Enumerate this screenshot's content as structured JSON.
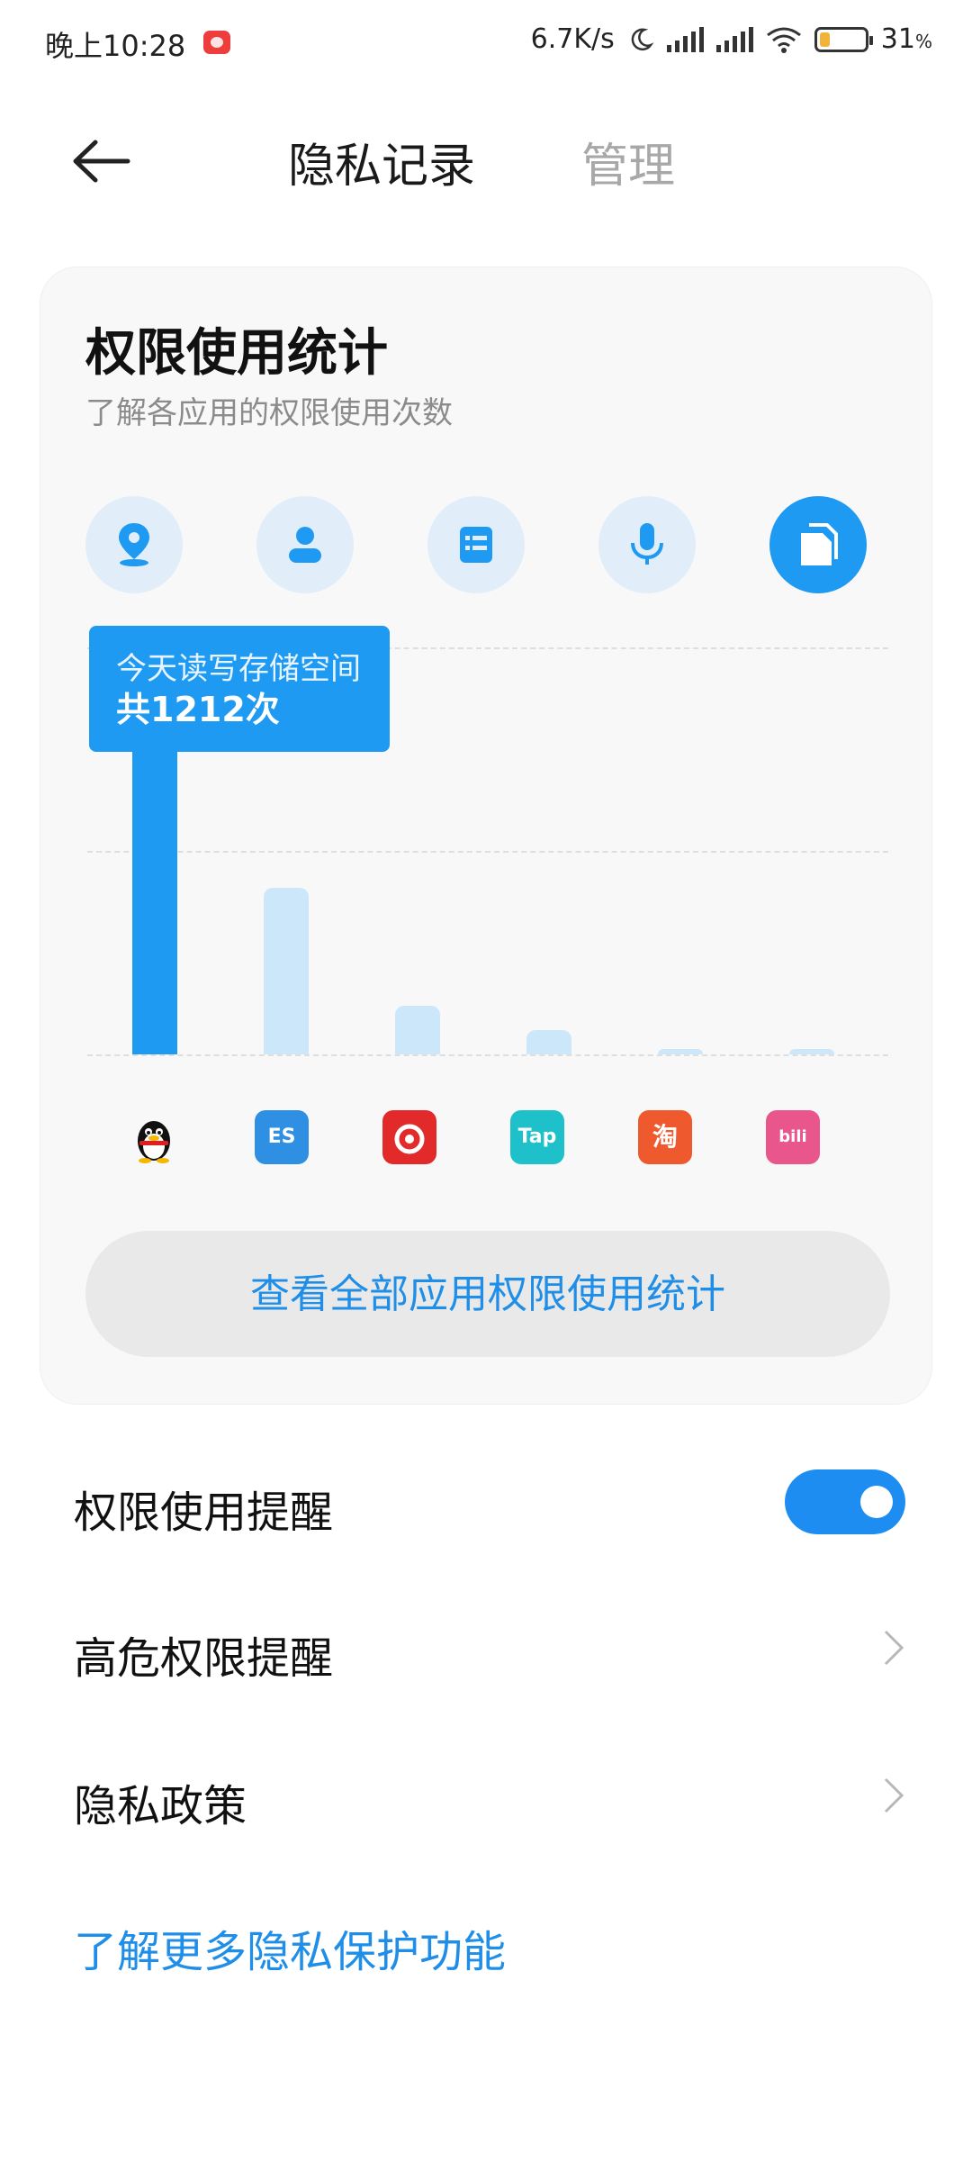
{
  "status_bar": {
    "time": "晚上10:28",
    "net_speed": "6.7K/s",
    "battery": "31",
    "battery_unit": "%",
    "battery_level_pct": 31
  },
  "header": {
    "title": "隐私记录",
    "manage": "管理"
  },
  "card": {
    "title": "权限使用统计",
    "subtitle": "了解各应用的权限使用次数",
    "permissions": [
      {
        "icon": "location-icon",
        "active": false
      },
      {
        "icon": "contacts-icon",
        "active": false
      },
      {
        "icon": "sms-icon",
        "active": false
      },
      {
        "icon": "microphone-icon",
        "active": false
      },
      {
        "icon": "storage-icon",
        "active": true
      }
    ],
    "tooltip": {
      "line1": "今天读写存储空间",
      "line2": "共1212次"
    },
    "apps": [
      {
        "icon": "qq-icon",
        "color": "#111111"
      },
      {
        "icon": "es-file-explorer-icon",
        "color": "#2f8fe3",
        "text": "ES"
      },
      {
        "icon": "netease-music-icon",
        "color": "#e22a2a"
      },
      {
        "icon": "taptap-icon",
        "color": "#1ec0c9",
        "text": "Tap"
      },
      {
        "icon": "taobao-icon",
        "color": "#ee5a2d",
        "text": "淘"
      },
      {
        "icon": "bilibili-icon",
        "color": "#e9568c",
        "text": "bili"
      }
    ],
    "button": "查看全部应用权限使用统计"
  },
  "chart_data": {
    "type": "bar",
    "title": "",
    "xlabel": "",
    "ylabel": "",
    "categories": [
      "qq",
      "es-file-explorer",
      "netease-music",
      "taptap",
      "taobao",
      "bilibili"
    ],
    "values": [
      1212,
      410,
      120,
      60,
      8,
      5
    ],
    "ylim": [
      0,
      1000
    ],
    "grid": true,
    "highlight_index": 0
  },
  "list": {
    "permission_reminder": "权限使用提醒",
    "permission_reminder_on": true,
    "high_risk_reminder": "高危权限提醒",
    "privacy_policy": "隐私政策",
    "learn_more": "了解更多隐私保护功能"
  },
  "colors": {
    "accent": "#1e9af2",
    "bar_inactive": "#cde7fa",
    "link": "#1f8ee8"
  }
}
